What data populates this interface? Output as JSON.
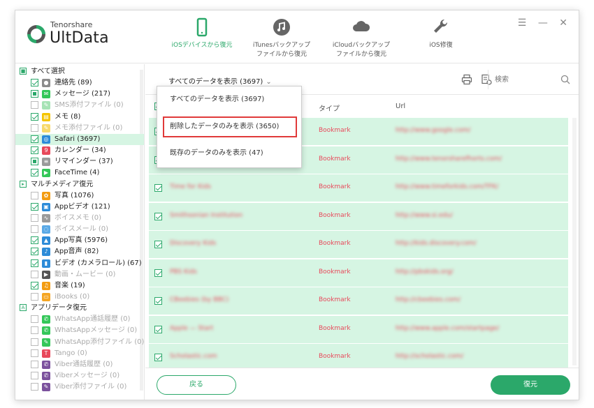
{
  "app": {
    "brand_small": "Tenorshare",
    "brand_big": "UltData",
    "accent_color": "#2ba86a"
  },
  "nav": [
    {
      "label": "iOSデバイスから復元",
      "icon": "phone-icon",
      "active": true
    },
    {
      "label": "iTunesバックアップ\nファイルから復元",
      "icon": "music-note-icon",
      "active": false
    },
    {
      "label": "iCloudバックアップ\nファイルから復元",
      "icon": "cloud-icon",
      "active": false
    },
    {
      "label": "iOS修復",
      "icon": "wrench-icon",
      "active": false
    }
  ],
  "window_controls": [
    "☰",
    "—",
    "✕"
  ],
  "sidebar": {
    "rows": [
      {
        "kind": "section",
        "label": "すべて選択",
        "toggle": "■"
      },
      {
        "kind": "item",
        "label": "連絡先 (89)",
        "state": "checked",
        "icon_color": "#8c8c8c",
        "icon_glyph": "●",
        "disabled": false
      },
      {
        "kind": "item",
        "label": "メッセージ (217)",
        "state": "partial",
        "icon_color": "#34c759",
        "icon_glyph": "✉",
        "disabled": false
      },
      {
        "kind": "item",
        "label": "SMS添付ファイル (0)",
        "state": "none",
        "icon_color": "#a6e3b5",
        "icon_glyph": "✎",
        "disabled": true
      },
      {
        "kind": "item",
        "label": "メモ (8)",
        "state": "checked",
        "icon_color": "#f5c400",
        "icon_glyph": "▤",
        "disabled": false
      },
      {
        "kind": "item",
        "label": "メモ添付ファイル (0)",
        "state": "none",
        "icon_color": "#f7d96b",
        "icon_glyph": "✎",
        "disabled": true
      },
      {
        "kind": "item",
        "label": "Safari (3697)",
        "state": "checked",
        "icon_color": "#2d8bd8",
        "icon_glyph": "◎",
        "disabled": false,
        "selected": true
      },
      {
        "kind": "item",
        "label": "カレンダー (34)",
        "state": "checked",
        "icon_color": "#e8485a",
        "icon_glyph": "9",
        "disabled": false
      },
      {
        "kind": "item",
        "label": "リマインダー (37)",
        "state": "partial",
        "icon_color": "#9a9a9a",
        "icon_glyph": "≡",
        "disabled": false
      },
      {
        "kind": "item",
        "label": "FaceTime (4)",
        "state": "checked",
        "icon_color": "#34c759",
        "icon_glyph": "▶",
        "disabled": false
      },
      {
        "kind": "section",
        "label": "マルチメディア復元",
        "toggle": "▸"
      },
      {
        "kind": "item",
        "label": "写真 (1076)",
        "state": "none",
        "icon_color": "#f39c12",
        "icon_glyph": "✿",
        "disabled": false
      },
      {
        "kind": "item",
        "label": "Appビデオ (121)",
        "state": "checked",
        "icon_color": "#2d8bd8",
        "icon_glyph": "▣",
        "disabled": false
      },
      {
        "kind": "item",
        "label": "ボイスメモ (0)",
        "state": "none",
        "icon_color": "#9a9a9a",
        "icon_glyph": "∿",
        "disabled": true
      },
      {
        "kind": "item",
        "label": "ボイスメール (0)",
        "state": "none",
        "icon_color": "#5aa9e6",
        "icon_glyph": "◌",
        "disabled": true
      },
      {
        "kind": "item",
        "label": "App写真 (5976)",
        "state": "checked",
        "icon_color": "#2d8bd8",
        "icon_glyph": "▲",
        "disabled": false
      },
      {
        "kind": "item",
        "label": "App音声 (82)",
        "state": "checked",
        "icon_color": "#2d8bd8",
        "icon_glyph": "♪",
        "disabled": false
      },
      {
        "kind": "item",
        "label": "ビデオ (カメラロール) (67)",
        "state": "checked",
        "icon_color": "#2d8bd8",
        "icon_glyph": "▮",
        "disabled": false
      },
      {
        "kind": "item",
        "label": "動画・ムービー (0)",
        "state": "none",
        "icon_color": "#555555",
        "icon_glyph": "▶",
        "disabled": true
      },
      {
        "kind": "item",
        "label": "音楽 (19)",
        "state": "checked",
        "icon_color": "#f39c12",
        "icon_glyph": "♫",
        "disabled": false
      },
      {
        "kind": "item",
        "label": "iBooks (0)",
        "state": "none",
        "icon_color": "#f5a623",
        "icon_glyph": "▭",
        "disabled": true
      },
      {
        "kind": "section",
        "label": "アプリデータ復元",
        "toggle": "A"
      },
      {
        "kind": "item",
        "label": "WhatsApp通話履歴 (0)",
        "state": "none",
        "icon_color": "#34c759",
        "icon_glyph": "✆",
        "disabled": true
      },
      {
        "kind": "item",
        "label": "WhatsAppメッセージ (0)",
        "state": "none",
        "icon_color": "#34c759",
        "icon_glyph": "✆",
        "disabled": true
      },
      {
        "kind": "item",
        "label": "WhatsApp添付ファイル (0)",
        "state": "none",
        "icon_color": "#34c759",
        "icon_glyph": "✎",
        "disabled": true
      },
      {
        "kind": "item",
        "label": "Tango (0)",
        "state": "none",
        "icon_color": "#e8485a",
        "icon_glyph": "T",
        "disabled": true
      },
      {
        "kind": "item",
        "label": "Viber通話履歴 (0)",
        "state": "none",
        "icon_color": "#7b519d",
        "icon_glyph": "✆",
        "disabled": true
      },
      {
        "kind": "item",
        "label": "Viberメッセージ (0)",
        "state": "none",
        "icon_color": "#7b519d",
        "icon_glyph": "✆",
        "disabled": true
      },
      {
        "kind": "item",
        "label": "Viber添付ファイル (0)",
        "state": "none",
        "icon_color": "#7b519d",
        "icon_glyph": "✎",
        "disabled": true
      }
    ]
  },
  "toolbar": {
    "filter_label": "すべてのデータを表示 (3697)",
    "filter_caret": "⌄",
    "search_placeholder": "検索"
  },
  "dropdown": {
    "items": [
      {
        "label": "すべてのデータを表示 (3697)",
        "highlight": false
      },
      {
        "label": "削除したデータのみを表示 (3650)",
        "highlight": true
      },
      {
        "label": "既存のデータのみを表示 (47)",
        "highlight": false
      }
    ]
  },
  "table": {
    "col_type": "タイプ",
    "col_url": "Url",
    "rows": [
      {
        "name": "Google Search",
        "type": "Bookmark",
        "url": "http://www.google.com/"
      },
      {
        "name": "TenorsharePhotos",
        "type": "Bookmark",
        "url": "http://www.tenorsharefhorts.com/"
      },
      {
        "name": "Time for Kids",
        "type": "Bookmark",
        "url": "http://www.timeforkids.com/TFK/"
      },
      {
        "name": "Smithsonian Institution",
        "type": "Bookmark",
        "url": "http://www.si.edu/"
      },
      {
        "name": "Discovery Kids",
        "type": "Bookmark",
        "url": "http://kids.discovery.com/"
      },
      {
        "name": "PBS Kids",
        "type": "Bookmark",
        "url": "http://pbskids.org/"
      },
      {
        "name": "CBeebies (by BBC)",
        "type": "Bookmark",
        "url": "http://cbeebies.com/"
      },
      {
        "name": "Apple — Start",
        "type": "Bookmark",
        "url": "http://www.apple.com/startpage/"
      },
      {
        "name": "Scholastic.com",
        "type": "Bookmark",
        "url": "http://scholastic.com/"
      }
    ]
  },
  "footer": {
    "back_label": "戻る",
    "recover_label": "復元"
  }
}
